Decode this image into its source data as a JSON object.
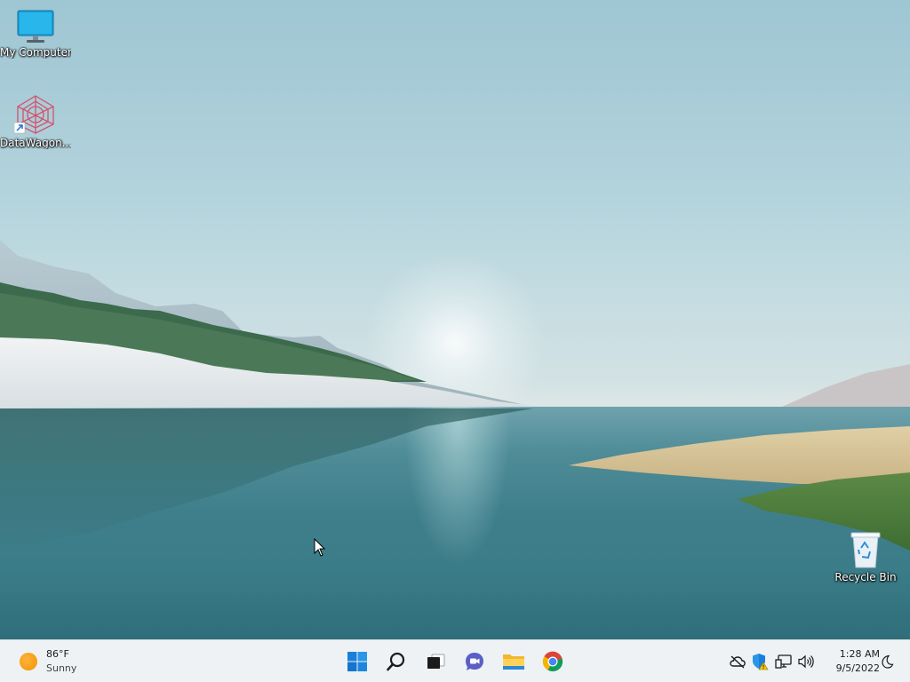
{
  "desktop": {
    "icons": [
      {
        "label": "My Computer",
        "icon": "monitor-icon"
      },
      {
        "label": "DataWagon...",
        "icon": "datawagon-app-icon"
      },
      {
        "label": "Recycle Bin",
        "icon": "recycle-bin-icon"
      }
    ]
  },
  "taskbar": {
    "weather": {
      "temperature": "86°F",
      "condition": "Sunny",
      "icon": "sun-icon"
    },
    "apps": [
      {
        "name": "Start",
        "icon": "windows-start-icon"
      },
      {
        "name": "Search",
        "icon": "search-icon"
      },
      {
        "name": "Task View",
        "icon": "task-view-icon"
      },
      {
        "name": "Chat",
        "icon": "chat-icon"
      },
      {
        "name": "File Explorer",
        "icon": "folder-icon"
      },
      {
        "name": "Google Chrome",
        "icon": "chrome-icon"
      }
    ],
    "tray": {
      "icons": [
        "cloud-offline-icon",
        "security-warning-icon",
        "network-icon",
        "volume-icon"
      ],
      "time": "1:28 AM",
      "date": "9/5/2022",
      "focus_icon": "moon-icon"
    }
  }
}
